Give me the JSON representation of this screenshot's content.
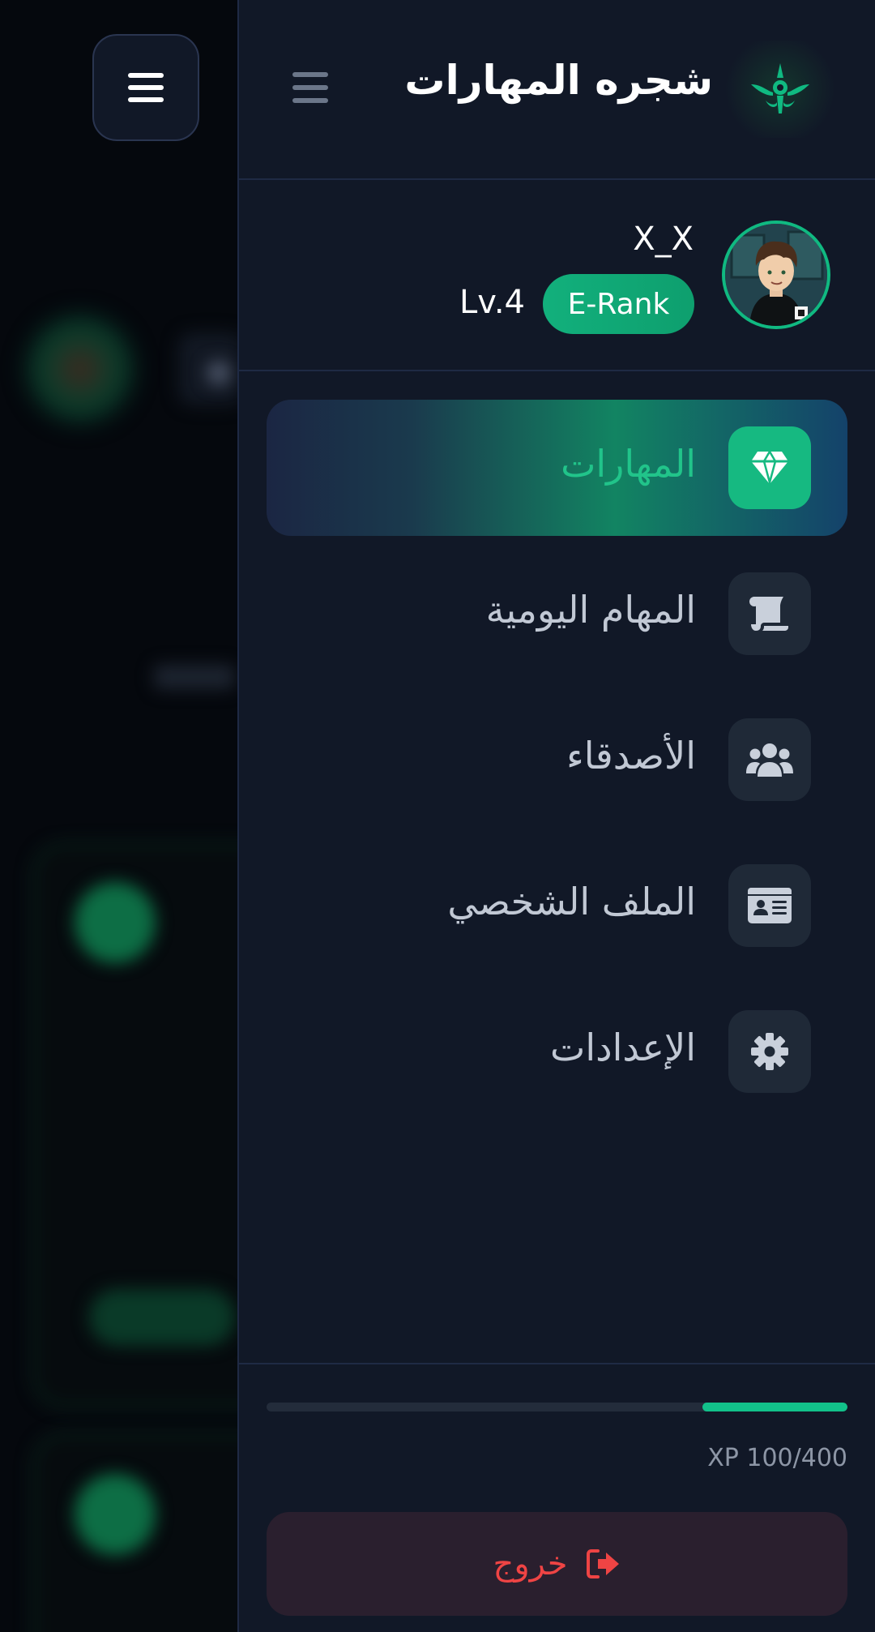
{
  "app": {
    "title": "شجره المهارات"
  },
  "user": {
    "name": "X_X",
    "rank": "E-Rank",
    "level": "Lv.4"
  },
  "nav": {
    "items": [
      {
        "label": "المهارات",
        "icon": "gem-icon",
        "active": true
      },
      {
        "label": "المهام اليومية",
        "icon": "scroll-icon",
        "active": false
      },
      {
        "label": "الأصدقاء",
        "icon": "users-icon",
        "active": false
      },
      {
        "label": "الملف الشخصي",
        "icon": "id-card-icon",
        "active": false
      },
      {
        "label": "الإعدادات",
        "icon": "gear-icon",
        "active": false
      }
    ]
  },
  "xp": {
    "text": "XP 100/400",
    "current": 100,
    "max": 400
  },
  "logout": {
    "label": "خروج",
    "icon": "sign-out-icon"
  },
  "colors": {
    "accent": "#10b981",
    "drawer_bg": "#111827",
    "danger": "#ef4444"
  }
}
